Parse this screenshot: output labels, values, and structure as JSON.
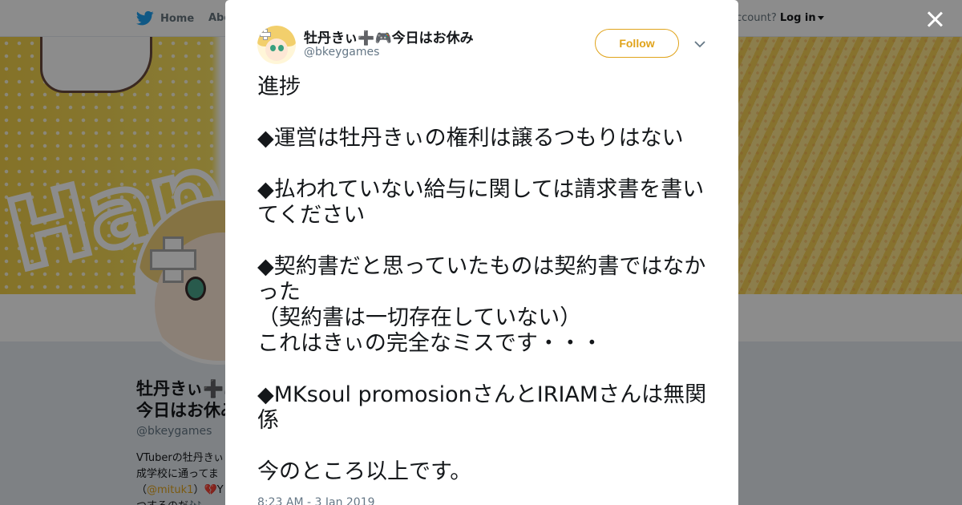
{
  "nav": {
    "home_label": "Home",
    "about_label": "Abo",
    "login_prompt": "ccount?",
    "login_label": "Log in"
  },
  "background_profile": {
    "name": "牡丹きぃ➕🎮今日はお休み",
    "handle": "@bkeygames",
    "bio_line1": "VTuberの牡丹きぃ",
    "bio_line2": "成学校に通ってま",
    "bio_mention_prefix": "（",
    "bio_mention": "@mituk1",
    "bio_mention_suffix": "）💔Y",
    "bio_line4": "つするのだ🎶..."
  },
  "tweet": {
    "author_name": "牡丹きぃ➕🎮今日はお休み",
    "author_handle": "@bkeygames",
    "follow_label": "Follow",
    "text": "進捗\n\n◆運営は牡丹きぃの権利は譲るつもりはない\n\n◆払われていない給与に関しては請求書を書いてください\n\n◆契約書だと思っていたものは契約書ではなかった\n（契約書は一切存在していない）\nこれはきぃの完全なミスです・・・\n\n◆MKsoul promosionさんとIRIAMさんは無関係\n\n今のところ以上です。",
    "timestamp": "8:23 AM - 3 Jan 2019"
  },
  "icons": {
    "nav_home": "twitter-bird-icon",
    "close": "close-icon",
    "more": "chevron-down-icon"
  },
  "colors": {
    "accent": "#e0a31a",
    "twitter_blue": "#1da1f2",
    "text_primary": "#14171a",
    "text_secondary": "#657786"
  }
}
